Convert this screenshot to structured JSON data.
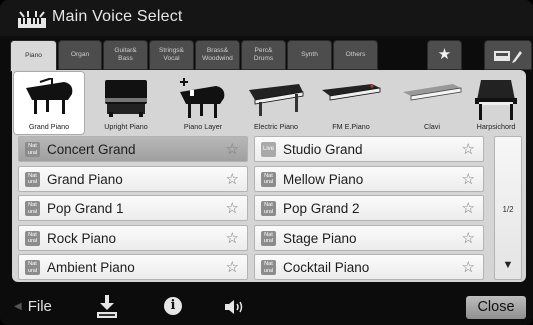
{
  "title": "Main Voice Select",
  "tabs": [
    {
      "label": "Piano",
      "active": true
    },
    {
      "label": "Organ",
      "active": false
    },
    {
      "label": "Guitar&\nBass",
      "active": false
    },
    {
      "label": "Strings&\nVocal",
      "active": false
    },
    {
      "label": "Brass&\nWoodwind",
      "active": false
    },
    {
      "label": "Perc&\nDrums",
      "active": false
    },
    {
      "label": "Synth",
      "active": false
    },
    {
      "label": "Others",
      "active": false
    },
    {
      "label": "★",
      "icon": "favorite-star-icon",
      "active": false
    },
    {
      "label": "",
      "icon": "user-drive-edit-icon",
      "active": false
    }
  ],
  "subcategories": [
    {
      "label": "Grand Piano",
      "icon": "grand-piano-icon",
      "active": true
    },
    {
      "label": "Upright Piano",
      "icon": "upright-piano-icon",
      "active": false
    },
    {
      "label": "Piano Layer",
      "icon": "piano-layer-icon",
      "active": false
    },
    {
      "label": "Electric Piano",
      "icon": "electric-piano-icon",
      "active": false
    },
    {
      "label": "FM E.Piano",
      "icon": "fm-epiano-icon",
      "active": false
    },
    {
      "label": "Clavi",
      "icon": "clavi-icon",
      "active": false
    },
    {
      "label": "Harpsichord",
      "icon": "harpsichord-icon",
      "active": false
    }
  ],
  "voices": [
    {
      "name": "Concert Grand",
      "badge": "Nat\nural",
      "badge_type": "natural",
      "selected": true
    },
    {
      "name": "Studio Grand",
      "badge": "Live",
      "badge_type": "live",
      "selected": false
    },
    {
      "name": "Grand Piano",
      "badge": "Nat\nural",
      "badge_type": "natural",
      "selected": false
    },
    {
      "name": "Mellow Piano",
      "badge": "Nat\nural",
      "badge_type": "natural",
      "selected": false
    },
    {
      "name": "Pop Grand 1",
      "badge": "Nat\nural",
      "badge_type": "natural",
      "selected": false
    },
    {
      "name": "Pop Grand 2",
      "badge": "Nat\nural",
      "badge_type": "natural",
      "selected": false
    },
    {
      "name": "Rock Piano",
      "badge": "Nat\nural",
      "badge_type": "natural",
      "selected": false
    },
    {
      "name": "Stage Piano",
      "badge": "Nat\nural",
      "badge_type": "natural",
      "selected": false
    },
    {
      "name": "Ambient Piano",
      "badge": "Nat\nural",
      "badge_type": "natural",
      "selected": false
    },
    {
      "name": "Cocktail Piano",
      "badge": "Nat\nural",
      "badge_type": "natural",
      "selected": false
    }
  ],
  "favorite_glyph": "☆",
  "pager": {
    "page": "1/2",
    "down_glyph": "▼"
  },
  "bottom": {
    "file_label": "File",
    "info_glyph": "i",
    "close_label": "Close",
    "icons": [
      "file-back-arrow-icon",
      "save-icon",
      "info-icon",
      "volume-icon"
    ]
  },
  "colors": {
    "screen_bg": "#0c0c0c",
    "panel_bg": "#d5d5d5",
    "tab_bg": "#4d4d4d",
    "tab_active_bg": "#d9d9d9",
    "selected_row": "#a8a8a8"
  }
}
